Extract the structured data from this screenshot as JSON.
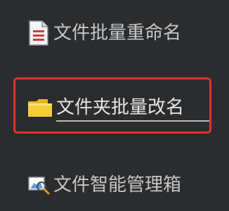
{
  "menu": {
    "items": [
      {
        "label": "文件批量重命名",
        "icon": "document-list-icon"
      },
      {
        "label": "文件夹批量改名",
        "icon": "folder-icon"
      },
      {
        "label": "文件智能管理箱",
        "icon": "magnifier-picture-icon"
      }
    ]
  },
  "colors": {
    "background": "#2b2c2e",
    "text": "#c6c6c6",
    "highlight_border": "#e53229",
    "folder": "#f2c62f",
    "document_accent": "#d23b3b"
  }
}
